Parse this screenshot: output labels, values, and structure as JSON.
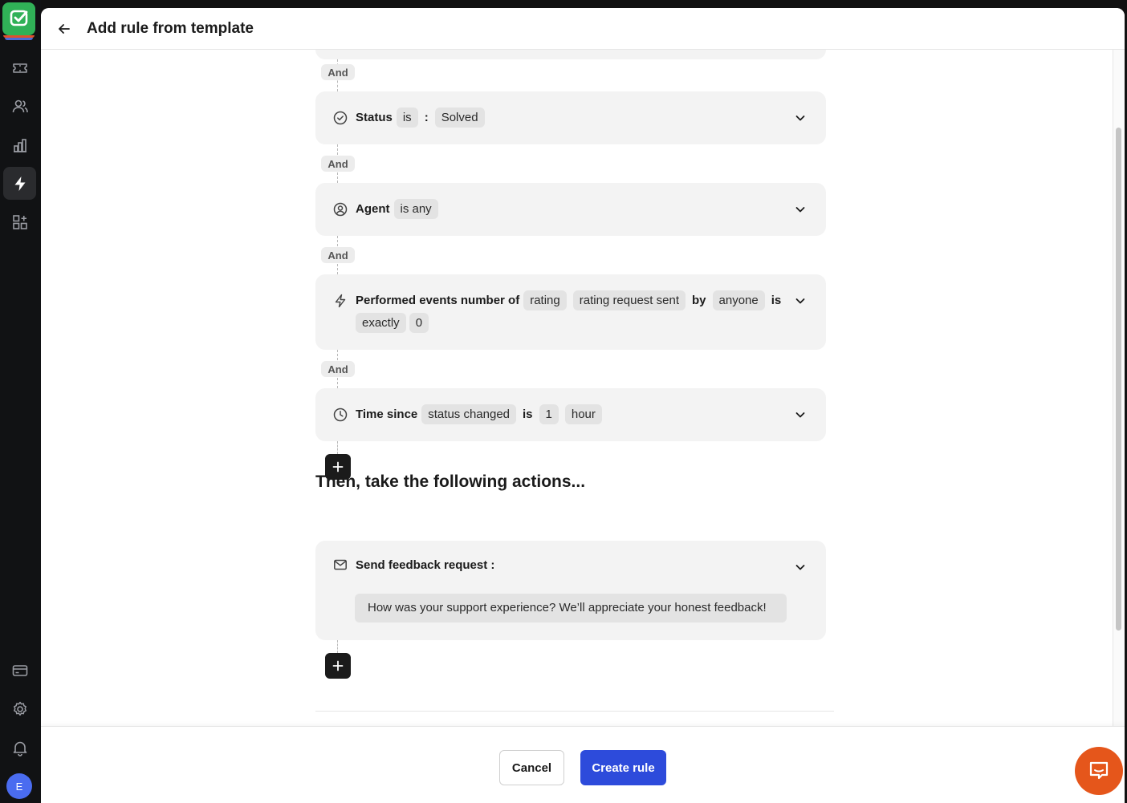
{
  "header": {
    "title": "Add rule from template"
  },
  "sidebar": {
    "items": [
      {
        "icon": "ticket-icon"
      },
      {
        "icon": "users-icon"
      },
      {
        "icon": "bar-chart-icon"
      },
      {
        "icon": "lightning-icon",
        "active": true
      },
      {
        "icon": "apps-plus-icon"
      },
      {
        "icon": "billing-card-icon"
      },
      {
        "icon": "gear-icon"
      },
      {
        "icon": "bell-icon"
      }
    ],
    "avatar_initial": "E"
  },
  "conditions": {
    "and_label": "And",
    "status": {
      "label": "Status",
      "operator": "is",
      "colon": ":",
      "value": "Solved"
    },
    "agent": {
      "label": "Agent",
      "operator": "is any"
    },
    "events": {
      "label": "Performed events number of",
      "event_type": "rating",
      "event": "rating request sent",
      "by_label": "by",
      "actor": "anyone",
      "is_label": "is",
      "comparator": "exactly",
      "count": "0"
    },
    "time": {
      "label": "Time since",
      "event": "status changed",
      "is_label": "is",
      "amount": "1",
      "unit": "hour"
    }
  },
  "actions": {
    "section_title": "Then, take the following actions...",
    "feedback": {
      "label": "Send feedback request :",
      "message": "How was your support experience? We’ll appreciate your honest feedback!"
    }
  },
  "footer": {
    "cancel_label": "Cancel",
    "create_label": "Create rule"
  },
  "colors": {
    "primary": "#2d4bdb",
    "chat": "#e5561b",
    "rail": "#111214",
    "card": "#f3f3f3",
    "chip": "#e3e3e3"
  }
}
